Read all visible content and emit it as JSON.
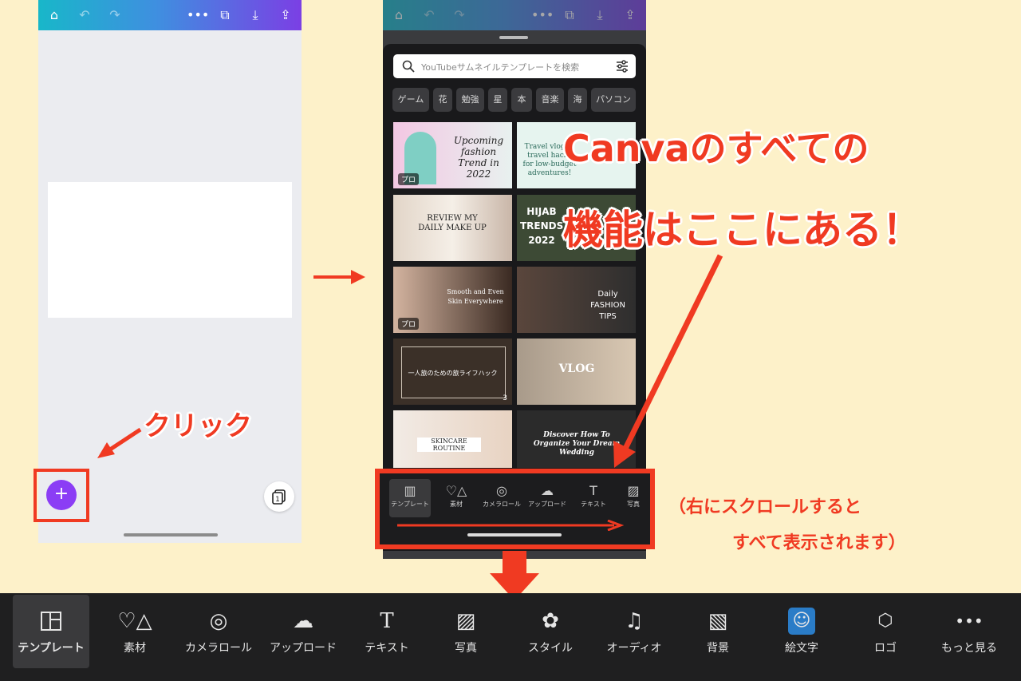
{
  "left_phone": {
    "add_button": "+",
    "page_count": "1"
  },
  "right_phone": {
    "search_placeholder": "YouTubeサムネイルテンプレートを検索",
    "chips": [
      "ゲーム",
      "花",
      "勉強",
      "星",
      "本",
      "音楽",
      "海",
      "パソコン"
    ],
    "thumbnails": [
      {
        "text": "Upcoming fashion Trend in 2022",
        "badge": "プロ"
      },
      {
        "text": "Travel vlog — travel hacks for low-budget adventures!",
        "badge": ""
      },
      {
        "text": "REVIEW MY DAILY MAKE UP",
        "badge": ""
      },
      {
        "text": "HIJAB TRENDS 2022",
        "badge": ""
      },
      {
        "text": "Smooth and Even Skin Everywhere",
        "badge": "プロ"
      },
      {
        "text": "Daily FASHION TIPS",
        "badge": ""
      },
      {
        "text": "一人旅のための旅ライフハック",
        "badge": "3"
      },
      {
        "text": "VLOG",
        "badge": ""
      },
      {
        "text": "SKINCARE ROUTINE",
        "badge": ""
      },
      {
        "text": "Discover How To Organize Your Dream Wedding",
        "badge": ""
      }
    ],
    "mini_toolbar": [
      "テンプレート",
      "素材",
      "カメラロール",
      "アップロード",
      "テキスト",
      "写真"
    ]
  },
  "annotations": {
    "headline_line1": "Canvaのすべての",
    "headline_line2": "機能はここにある！",
    "click": "クリック",
    "note_line1": "（右にスクロールすると",
    "note_line2": "すべて表示されます）",
    "accent_color": "#f03a22"
  },
  "bottom_toolbar": {
    "items": [
      {
        "label": "テンプレート",
        "icon": "template-icon"
      },
      {
        "label": "素材",
        "icon": "elements-icon"
      },
      {
        "label": "カメラロール",
        "icon": "camera-icon"
      },
      {
        "label": "アップロード",
        "icon": "upload-icon"
      },
      {
        "label": "テキスト",
        "icon": "text-icon"
      },
      {
        "label": "写真",
        "icon": "photo-icon"
      },
      {
        "label": "スタイル",
        "icon": "palette-icon"
      },
      {
        "label": "オーディオ",
        "icon": "music-icon"
      },
      {
        "label": "背景",
        "icon": "background-icon"
      },
      {
        "label": "絵文字",
        "icon": "emoji-icon"
      },
      {
        "label": "ロゴ",
        "icon": "logo-icon"
      },
      {
        "label": "もっと見る",
        "icon": "more-icon"
      }
    ]
  }
}
